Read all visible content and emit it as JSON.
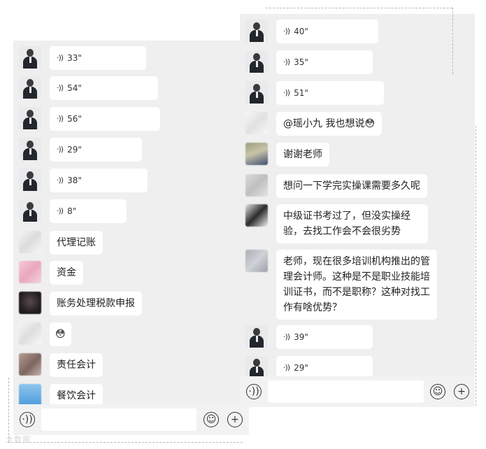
{
  "left_chat": {
    "messages": [
      {
        "sender": "teacher",
        "type": "voice",
        "duration": "33\""
      },
      {
        "sender": "teacher",
        "type": "voice",
        "duration": "54\""
      },
      {
        "sender": "teacher",
        "type": "voice",
        "duration": "56\""
      },
      {
        "sender": "teacher",
        "type": "voice",
        "duration": "29\""
      },
      {
        "sender": "teacher",
        "type": "voice",
        "duration": "38\""
      },
      {
        "sender": "teacher",
        "type": "voice",
        "duration": "8\""
      },
      {
        "sender": "member",
        "type": "text",
        "text": "代理记账"
      },
      {
        "sender": "member",
        "type": "text",
        "text": "资金"
      },
      {
        "sender": "member",
        "type": "text",
        "text": "账务处理税款申报"
      },
      {
        "sender": "member",
        "type": "emoji",
        "text": "😳"
      },
      {
        "sender": "member",
        "type": "text",
        "text": "责任会计"
      },
      {
        "sender": "member",
        "type": "text",
        "text": "餐饮会计"
      }
    ]
  },
  "right_chat": {
    "messages": [
      {
        "sender": "teacher",
        "type": "voice",
        "duration": "40\""
      },
      {
        "sender": "teacher",
        "type": "voice",
        "duration": "35\""
      },
      {
        "sender": "teacher",
        "type": "voice",
        "duration": "51\""
      },
      {
        "sender": "member",
        "type": "text",
        "text": "@瑶小九  我也想说😳"
      },
      {
        "sender": "member",
        "type": "text",
        "text": "谢谢老师"
      },
      {
        "sender": "member",
        "type": "text",
        "text": "想问一下学完实操课需要多久呢"
      },
      {
        "sender": "member",
        "type": "text",
        "text": "中级证书考过了，但没实操经验，去找工作会不会很劣势"
      },
      {
        "sender": "member",
        "type": "text",
        "text": "老师，现在很多培训机构推出的管理会计师。这种是不是职业技能培训证书，而不是职称？这种对找工作有啥优势？"
      },
      {
        "sender": "teacher",
        "type": "voice",
        "duration": "39\""
      },
      {
        "sender": "teacher",
        "type": "voice",
        "duration": "29\""
      }
    ]
  },
  "input_bar": {
    "voice_icon": "voice-toggle-icon",
    "emoji_icon": "emoji-icon",
    "plus_icon": "plus-icon"
  },
  "watermark": "大数据"
}
